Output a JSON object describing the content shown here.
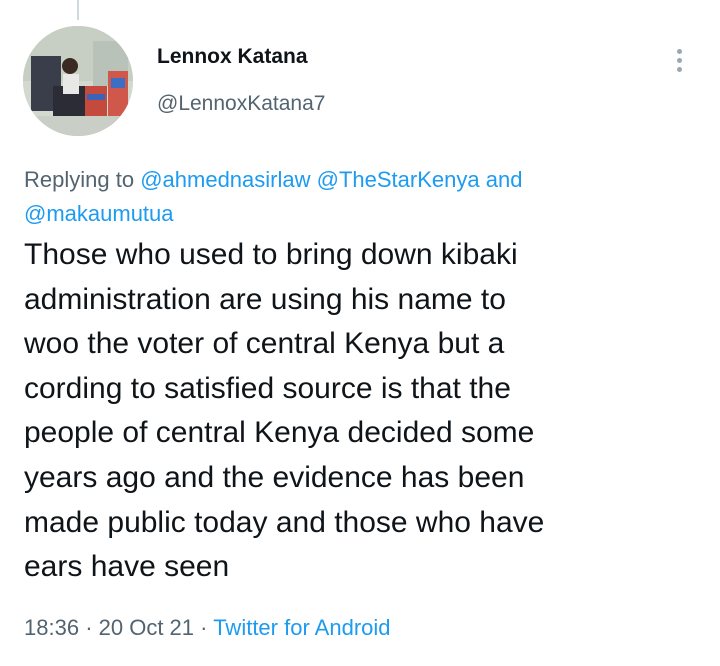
{
  "tweet": {
    "display_name": "Lennox Katana",
    "handle": "@LennoxKatana7",
    "reply_prefix": "Replying to",
    "reply_mentions": [
      "@ahmednasirlaw",
      "@TheStarKenya"
    ],
    "reply_and": "and",
    "reply_last_mention": "@makaumutua",
    "text": "Those who used to bring down kibaki\nadministration are using his name to\nwoo the voter of central Kenya but a\ncording to satisfied source is that the\npeople of central Kenya decided some\nyears ago and the evidence has been\nmade public today and those who have\nears have seen",
    "time": "18:36",
    "date": "20 Oct 21",
    "separator": "·",
    "source": "Twitter for Android"
  },
  "icons": {
    "more": "more-vertical-icon"
  },
  "colors": {
    "link": "#1d9bf0",
    "secondary_text": "#536471",
    "primary_text": "#0f1419"
  }
}
